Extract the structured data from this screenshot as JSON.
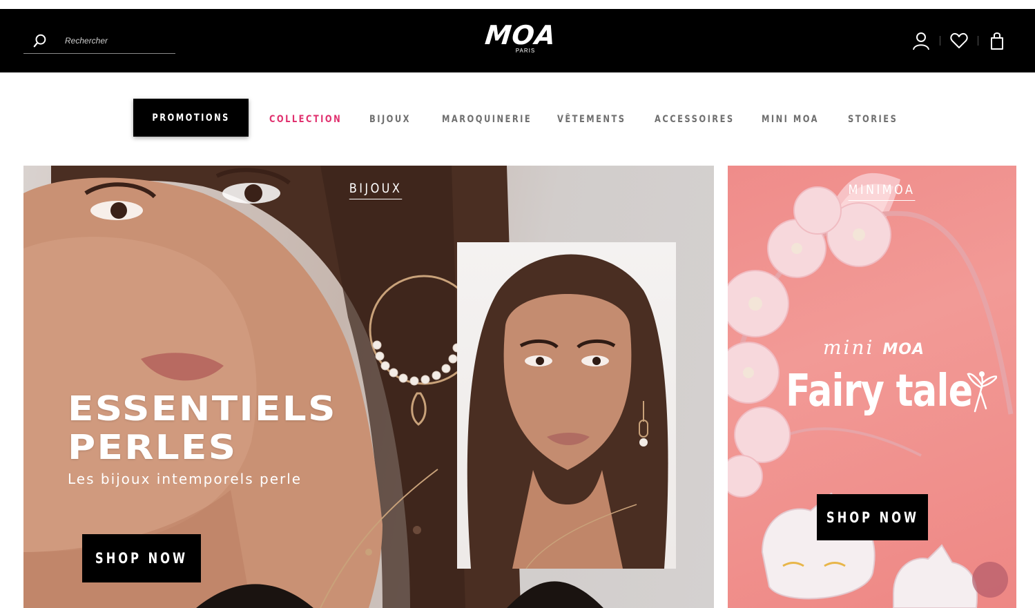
{
  "header": {
    "search_placeholder": "Rechercher",
    "logo_text": "MOA",
    "logo_subtext": "PARIS",
    "icons": [
      "search-icon",
      "user-icon",
      "heart-icon",
      "bag-icon"
    ]
  },
  "nav": {
    "items": [
      {
        "label": "PROMOTIONS",
        "state": "highlighted"
      },
      {
        "label": "COLLECTION",
        "state": "active",
        "color": "#e0306e"
      },
      {
        "label": "BIJOUX"
      },
      {
        "label": "MAROQUINERIE"
      },
      {
        "label": "VÊTEMENTS"
      },
      {
        "label": "ACCESSOIRES"
      },
      {
        "label": "MINI MOA"
      },
      {
        "label": "STORIES"
      }
    ]
  },
  "hero_main": {
    "tag": "BIJOUX",
    "headline_line1": "ESSENTIELS",
    "headline_line2": "PERLES",
    "subtitle": "Les bijoux intemporels perle",
    "cta": "SHOP NOW"
  },
  "hero_side": {
    "tag": "MINIMOA",
    "brand_prefix": "mini",
    "brand_suffix": "MOA",
    "title": "Fairy tale",
    "cta": "SHOP NOW"
  },
  "colors": {
    "header_bg": "#000000",
    "accent": "#e0306e",
    "side_banner_bg": "#f08e8b"
  }
}
